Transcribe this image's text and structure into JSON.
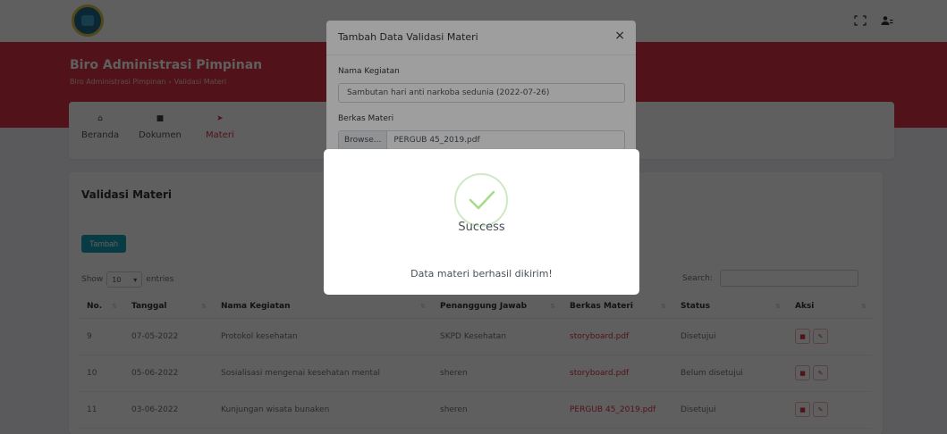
{
  "page": {
    "title": "Biro Administrasi Pimpinan",
    "breadcrumb": [
      "Biro Administrasi Pimpinan",
      "Validasi Materi"
    ]
  },
  "nav": {
    "items": [
      {
        "label": "Beranda",
        "icon": "home-icon"
      },
      {
        "label": "Dokumen",
        "icon": "document-icon"
      },
      {
        "label": "Materi",
        "icon": "send-icon"
      }
    ]
  },
  "card": {
    "title": "Validasi Materi",
    "add_label": "Tambah",
    "show_label": "Show",
    "entries_value": "10",
    "entries_label": "entries",
    "search_label": "Search:"
  },
  "table": {
    "headers": [
      "No.",
      "Tanggal",
      "Nama Kegiatan",
      "Penanggung Jawab",
      "Berkas Materi",
      "Status",
      "Aksi"
    ],
    "rows": [
      {
        "no": "9",
        "tanggal": "07-05-2022",
        "kegiatan": "Protokol kesehatan",
        "pj": "SKPD Kesehatan",
        "berkas": "storyboard.pdf",
        "status": "Disetujui"
      },
      {
        "no": "10",
        "tanggal": "05-06-2022",
        "kegiatan": "Sosialisasi mengenai kesehatan mental",
        "pj": "sheren",
        "berkas": "storyboard.pdf",
        "status": "Belum disetujui"
      },
      {
        "no": "11",
        "tanggal": "03-06-2022",
        "kegiatan": "Kunjungan wisata bunaken",
        "pj": "sheren",
        "berkas": "PERGUB 45_2019.pdf",
        "status": "Disetujui"
      }
    ]
  },
  "modal": {
    "title": "Tambah Data Validasi Materi",
    "close": "×",
    "field1_label": "Nama Kegiatan",
    "field1_value": "Sambutan hari anti narkoba sedunia (2022-07-26)",
    "field2_label": "Berkas Materi",
    "browse_label": "Browse...",
    "file_value": "PERGUB 45_2019.pdf"
  },
  "alert": {
    "title": "Success",
    "text": "Data materi berhasil dikirim!",
    "icon": "check-icon"
  },
  "colors": {
    "brand_red": "#dc3545",
    "accent_teal": "#17a2b8",
    "success_green": "#a5dc86"
  }
}
